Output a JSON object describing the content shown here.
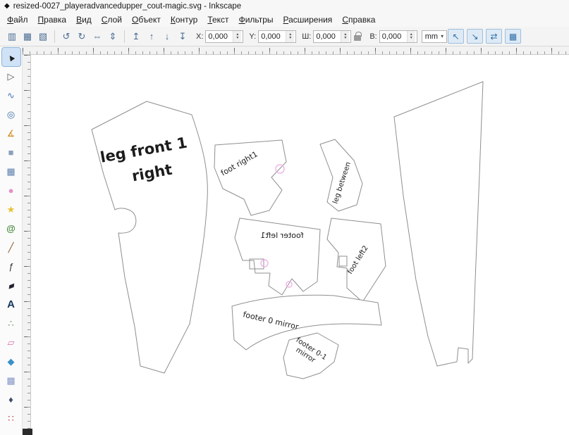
{
  "window": {
    "title": "resized-0027_playeradvancedupper_cout-magic.svg - Inkscape",
    "logo_glyph": "◆"
  },
  "menu": {
    "items": [
      "Файл",
      "Правка",
      "Вид",
      "Слой",
      "Объект",
      "Контур",
      "Текст",
      "Фильтры",
      "Расширения",
      "Справка"
    ]
  },
  "toolbar": {
    "icons_selection": [
      {
        "name": "selection-settings",
        "glyph": "▥"
      },
      {
        "name": "select-all",
        "glyph": "▦"
      },
      {
        "name": "deselect",
        "glyph": "▧"
      }
    ],
    "icons_transform": [
      {
        "name": "rotate-ccw",
        "glyph": "↺"
      },
      {
        "name": "rotate-cw",
        "glyph": "↻"
      },
      {
        "name": "flip-horizontal",
        "glyph": "⇔"
      },
      {
        "name": "flip-vertical",
        "glyph": "⇕"
      }
    ],
    "icons_zorder": [
      {
        "name": "raise-to-top",
        "glyph": "↥"
      },
      {
        "name": "raise",
        "glyph": "↑"
      },
      {
        "name": "lower",
        "glyph": "↓"
      },
      {
        "name": "lower-to-bottom",
        "glyph": "↧"
      }
    ],
    "fields": {
      "x_label": "X:",
      "x_value": "0,000",
      "y_label": "Y:",
      "y_value": "0,000",
      "w_label": "Ш:",
      "w_value": "0,000",
      "h_label": "В:",
      "h_value": "0,000"
    },
    "unit": "mm",
    "toggles": [
      {
        "name": "scale-stroke",
        "glyph": "↖"
      },
      {
        "name": "scale-corners",
        "glyph": "↘"
      },
      {
        "name": "move-gradients",
        "glyph": "⇄"
      },
      {
        "name": "move-patterns",
        "glyph": "▦"
      }
    ]
  },
  "tools": [
    {
      "name": "selector",
      "glyph": "▲"
    },
    {
      "name": "node-editor",
      "glyph": "▷"
    },
    {
      "name": "tweak",
      "glyph": "∿"
    },
    {
      "name": "zoom",
      "glyph": "◎"
    },
    {
      "name": "measure",
      "glyph": "∡"
    },
    {
      "name": "rectangle",
      "glyph": "■"
    },
    {
      "name": "box-3d",
      "glyph": "▦"
    },
    {
      "name": "ellipse",
      "glyph": "●"
    },
    {
      "name": "star",
      "glyph": "★"
    },
    {
      "name": "spiral",
      "glyph": "@"
    },
    {
      "name": "pencil",
      "glyph": "╱"
    },
    {
      "name": "bezier-pen",
      "glyph": "ƒ"
    },
    {
      "name": "calligraphy",
      "glyph": "▰"
    },
    {
      "name": "text",
      "glyph": "A"
    },
    {
      "name": "spray",
      "glyph": "∴"
    },
    {
      "name": "eraser",
      "glyph": "▱"
    },
    {
      "name": "paint-bucket",
      "glyph": "◆"
    },
    {
      "name": "gradient",
      "glyph": "▩"
    },
    {
      "name": "dropper",
      "glyph": "♦"
    },
    {
      "name": "connector",
      "glyph": "∷"
    }
  ],
  "canvas": {
    "labels": {
      "piece1_line1": "leg front 1",
      "piece1_line2": "right",
      "piece2": "foot right1",
      "piece3": "leg between",
      "piece4": "footer left1",
      "piece5": "foot left2",
      "piece6": "footer 0 mirror",
      "piece7_line1": "footer 0-1",
      "piece7_line2": "mirror"
    }
  }
}
